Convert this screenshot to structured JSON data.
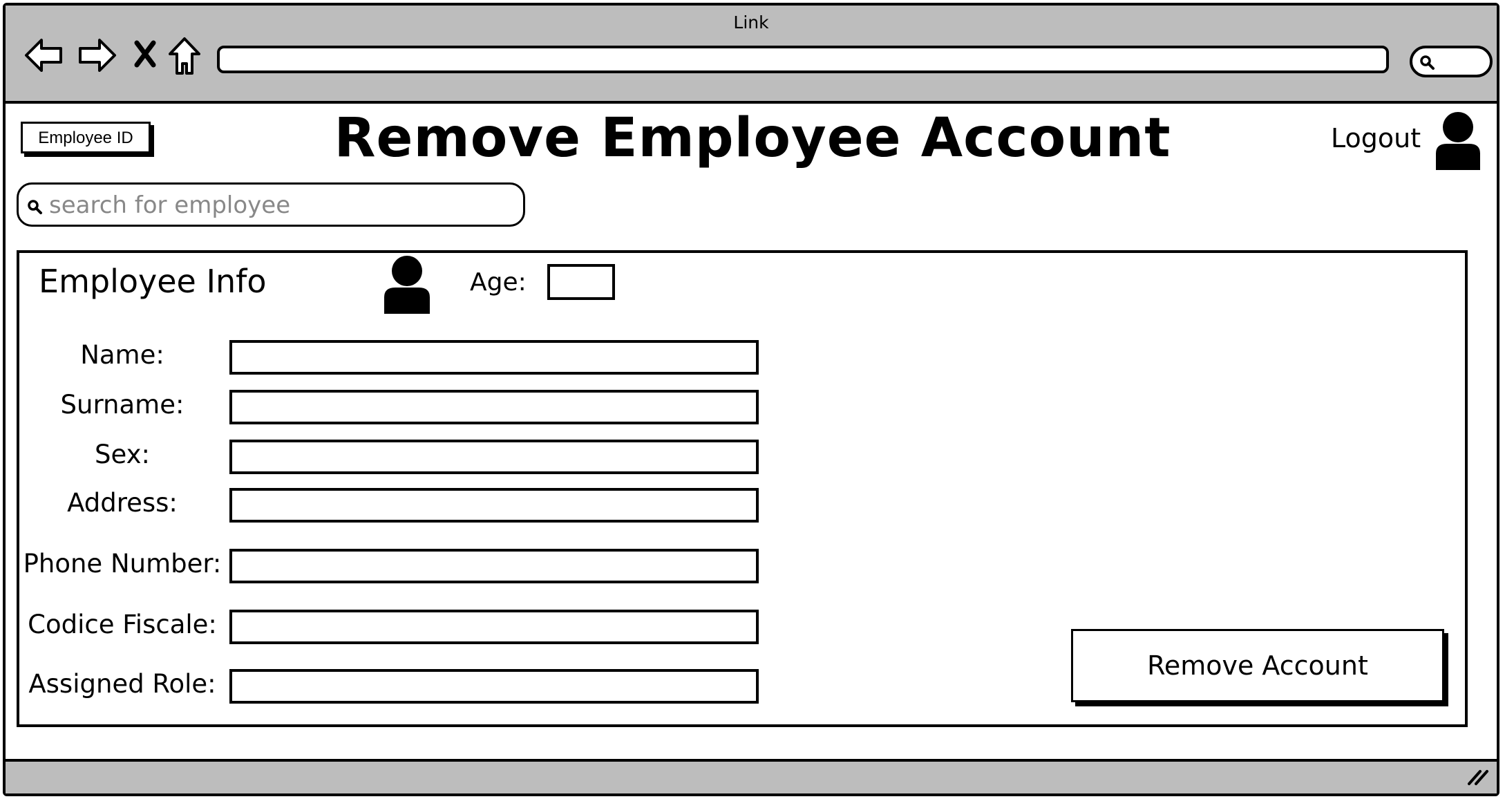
{
  "window": {
    "title": "Link",
    "address_value": "",
    "icons": [
      "back-arrow-icon",
      "forward-arrow-icon",
      "close-x-icon",
      "home-icon",
      "search-icon",
      "resize-grip-icon"
    ]
  },
  "header": {
    "employee_id_label": "Employee ID",
    "page_title": "Remove Employee Account",
    "logout_label": "Logout"
  },
  "search": {
    "placeholder": "search for employee",
    "value": ""
  },
  "employee_info": {
    "title": "Employee Info",
    "age_label": "Age:",
    "age_value": "",
    "fields": [
      {
        "label": "Name:",
        "value": ""
      },
      {
        "label": "Surname:",
        "value": ""
      },
      {
        "label": "Sex:",
        "value": ""
      },
      {
        "label": "Address:",
        "value": ""
      },
      {
        "label": "Phone Number:",
        "value": ""
      },
      {
        "label": "Codice Fiscale:",
        "value": ""
      },
      {
        "label": "Assigned Role:",
        "value": ""
      }
    ],
    "remove_button_label": "Remove Account"
  },
  "colors": {
    "chrome": "#bdbdbd",
    "border": "#000000",
    "placeholder": "#888888"
  }
}
